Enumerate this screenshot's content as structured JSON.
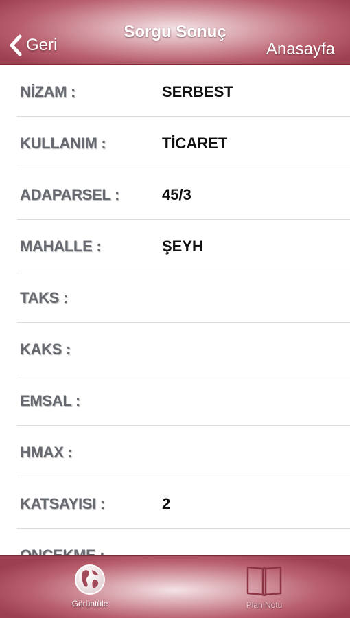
{
  "header": {
    "title": "Sorgu Sonuç",
    "back_label": "Geri",
    "home_label": "Anasayfa"
  },
  "rows": [
    {
      "label": "NİZAM :",
      "value": "SERBEST"
    },
    {
      "label": "KULLANIM :",
      "value": "TİCARET"
    },
    {
      "label": "ADAPARSEL :",
      "value": "45/3"
    },
    {
      "label": "MAHALLE :",
      "value": "ŞEYH"
    },
    {
      "label": "TAKS :",
      "value": ""
    },
    {
      "label": "KAKS :",
      "value": ""
    },
    {
      "label": "EMSAL :",
      "value": ""
    },
    {
      "label": "HMAX :",
      "value": ""
    },
    {
      "label": "KATSAYISI :",
      "value": "2"
    },
    {
      "label": "ONCEKME :",
      "value": ""
    }
  ],
  "footer": {
    "tabs": [
      {
        "label": "Görüntüle",
        "icon": "globe-icon"
      },
      {
        "label": "Plan Notu",
        "icon": "book-icon"
      }
    ]
  },
  "colors": {
    "bar_dark": "#9c3f50",
    "bar_light": "#f3e3e6",
    "label_gray": "#666a70"
  }
}
